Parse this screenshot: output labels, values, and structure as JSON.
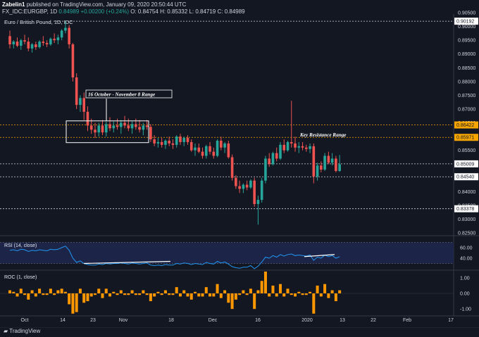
{
  "header": {
    "line1_user": "Zabelin1",
    "line1_rest": "published on TradingView.com, January 09, 2020 20:50:44 UTC",
    "symbol": "FX_IDC:EURGBP, 1D",
    "last": "0.84989",
    "change": "+0.00200 (+0.24%)",
    "o": "O: 0.84754",
    "h": "H: 0.85332",
    "l": "L: 0.84719",
    "c": "C: 0.84989"
  },
  "footer": {
    "brand": "TradingView"
  },
  "colors": {
    "bg": "#131722",
    "up": "#26a69a",
    "down": "#ef5350",
    "orange": "#f7a600",
    "rsi": "#2196f3",
    "roc": "#ff9800"
  },
  "chart_data": [
    {
      "type": "candlestick",
      "title": "Euro / British Pound, 1D, IDC",
      "ylim": [
        0.8245,
        0.9045
      ],
      "y_ticks": [
        "0.90500",
        "0.90000",
        "0.89500",
        "0.89000",
        "0.88500",
        "0.88000",
        "0.87500",
        "0.87000",
        "0.86500",
        "0.86000",
        "0.85500",
        "0.85000",
        "0.84500",
        "0.84000",
        "0.83500",
        "0.83000",
        "0.82500"
      ],
      "x_ticks": [
        "Oct",
        "14",
        "23",
        "Nov",
        "18",
        "Dec",
        "16",
        "2020",
        "13",
        "22",
        "Feb",
        "17"
      ],
      "price_labels": [
        {
          "text": "0.90192",
          "value": 0.90192
        },
        {
          "text": "0.86422",
          "value": 0.86422
        },
        {
          "text": "0.85971",
          "value": 0.85971
        },
        {
          "text": "0.85009",
          "value": 0.85009
        },
        {
          "text": "0.84540",
          "value": 0.8454
        },
        {
          "text": "0.83378",
          "value": 0.83378
        }
      ],
      "levels": [
        {
          "value": 0.90192,
          "style": "white-dashed"
        },
        {
          "value": 0.86422,
          "style": "orange-dashed"
        },
        {
          "value": 0.85971,
          "style": "orange-dashed"
        },
        {
          "value": 0.85009,
          "style": "white-dashed"
        },
        {
          "value": 0.8454,
          "style": "white-dashed"
        },
        {
          "value": 0.83378,
          "style": "white-dashed"
        }
      ],
      "annotations": {
        "range_label": "16 October - November 8 Range",
        "resistance_label": "Key Resistance Range"
      },
      "candles": [
        [
          0.8965,
          0.8985,
          0.892,
          0.8935
        ],
        [
          0.8935,
          0.895,
          0.892,
          0.8945
        ],
        [
          0.8945,
          0.896,
          0.8925,
          0.893
        ],
        [
          0.893,
          0.8955,
          0.8915,
          0.895
        ],
        [
          0.895,
          0.897,
          0.8935,
          0.8945
        ],
        [
          0.8945,
          0.896,
          0.891,
          0.892
        ],
        [
          0.892,
          0.894,
          0.8905,
          0.8935
        ],
        [
          0.8935,
          0.8945,
          0.8915,
          0.8925
        ],
        [
          0.8925,
          0.895,
          0.892,
          0.8945
        ],
        [
          0.8945,
          0.8965,
          0.893,
          0.894
        ],
        [
          0.894,
          0.895,
          0.8925,
          0.8935
        ],
        [
          0.8935,
          0.896,
          0.893,
          0.8955
        ],
        [
          0.8955,
          0.8975,
          0.894,
          0.895
        ],
        [
          0.895,
          0.897,
          0.8935,
          0.896
        ],
        [
          0.896,
          0.899,
          0.895,
          0.8985
        ],
        [
          0.8985,
          0.9019,
          0.8975,
          0.8995
        ],
        [
          0.8995,
          0.9005,
          0.892,
          0.8935
        ],
        [
          0.8935,
          0.894,
          0.88,
          0.8815
        ],
        [
          0.8815,
          0.883,
          0.87,
          0.8715
        ],
        [
          0.8715,
          0.875,
          0.869,
          0.874
        ],
        [
          0.874,
          0.876,
          0.866,
          0.869
        ],
        [
          0.869,
          0.871,
          0.862,
          0.864
        ],
        [
          0.864,
          0.8665,
          0.861,
          0.8625
        ],
        [
          0.8625,
          0.865,
          0.8595,
          0.8615
        ],
        [
          0.8615,
          0.865,
          0.86,
          0.864
        ],
        [
          0.864,
          0.866,
          0.8605,
          0.8615
        ],
        [
          0.8615,
          0.8655,
          0.86,
          0.8645
        ],
        [
          0.8645,
          0.867,
          0.862,
          0.863
        ],
        [
          0.863,
          0.8655,
          0.8615,
          0.864
        ],
        [
          0.864,
          0.8665,
          0.8625,
          0.8635
        ],
        [
          0.8635,
          0.866,
          0.861,
          0.865
        ],
        [
          0.865,
          0.8675,
          0.863,
          0.864
        ],
        [
          0.864,
          0.8665,
          0.862,
          0.863
        ],
        [
          0.863,
          0.8655,
          0.861,
          0.8645
        ],
        [
          0.8645,
          0.8665,
          0.8625,
          0.8635
        ],
        [
          0.8635,
          0.866,
          0.8615,
          0.8625
        ],
        [
          0.8625,
          0.865,
          0.8605,
          0.864
        ],
        [
          0.864,
          0.866,
          0.8625,
          0.8635
        ],
        [
          0.8635,
          0.8645,
          0.858,
          0.859
        ],
        [
          0.859,
          0.8605,
          0.8565,
          0.8575
        ],
        [
          0.8575,
          0.8595,
          0.856,
          0.858
        ],
        [
          0.858,
          0.8595,
          0.856,
          0.857
        ],
        [
          0.857,
          0.859,
          0.8555,
          0.8585
        ],
        [
          0.8585,
          0.86,
          0.8565,
          0.8575
        ],
        [
          0.8575,
          0.859,
          0.8555,
          0.857
        ],
        [
          0.857,
          0.8605,
          0.856,
          0.86
        ],
        [
          0.86,
          0.861,
          0.857,
          0.858
        ],
        [
          0.858,
          0.86,
          0.8565,
          0.8595
        ],
        [
          0.8595,
          0.8605,
          0.857,
          0.858
        ],
        [
          0.858,
          0.859,
          0.8545,
          0.855
        ],
        [
          0.855,
          0.8575,
          0.853,
          0.856
        ],
        [
          0.856,
          0.8575,
          0.854,
          0.8545
        ],
        [
          0.8545,
          0.856,
          0.852,
          0.853
        ],
        [
          0.853,
          0.857,
          0.852,
          0.8565
        ],
        [
          0.8565,
          0.858,
          0.8535,
          0.8545
        ],
        [
          0.8545,
          0.856,
          0.852,
          0.853
        ],
        [
          0.853,
          0.859,
          0.8525,
          0.8585
        ],
        [
          0.8585,
          0.86,
          0.855,
          0.856
        ],
        [
          0.856,
          0.858,
          0.854,
          0.8575
        ],
        [
          0.8575,
          0.8585,
          0.852,
          0.8525
        ],
        [
          0.8525,
          0.8535,
          0.844,
          0.845
        ],
        [
          0.845,
          0.846,
          0.841,
          0.842
        ],
        [
          0.842,
          0.844,
          0.8395,
          0.841
        ],
        [
          0.841,
          0.843,
          0.8395,
          0.8425
        ],
        [
          0.8425,
          0.844,
          0.8405,
          0.8415
        ],
        [
          0.8415,
          0.8445,
          0.841,
          0.844
        ],
        [
          0.844,
          0.845,
          0.8345,
          0.8355
        ],
        [
          0.8355,
          0.8385,
          0.828,
          0.837
        ],
        [
          0.837,
          0.845,
          0.836,
          0.844
        ],
        [
          0.844,
          0.853,
          0.843,
          0.852
        ],
        [
          0.852,
          0.854,
          0.849,
          0.85
        ],
        [
          0.85,
          0.8545,
          0.8495,
          0.854
        ],
        [
          0.854,
          0.856,
          0.851,
          0.852
        ],
        [
          0.852,
          0.858,
          0.8515,
          0.857
        ],
        [
          0.857,
          0.859,
          0.854,
          0.855
        ],
        [
          0.855,
          0.8585,
          0.8545,
          0.858
        ],
        [
          0.858,
          0.873,
          0.856,
          0.8575
        ],
        [
          0.8575,
          0.86,
          0.8545,
          0.856
        ],
        [
          0.856,
          0.858,
          0.854,
          0.8565
        ],
        [
          0.8565,
          0.858,
          0.855,
          0.856
        ],
        [
          0.856,
          0.857,
          0.8545,
          0.8555
        ],
        [
          0.8555,
          0.8575,
          0.854,
          0.8565
        ],
        [
          0.8565,
          0.8575,
          0.843,
          0.8455
        ],
        [
          0.8455,
          0.8505,
          0.844,
          0.8495
        ],
        [
          0.8495,
          0.851,
          0.847,
          0.848
        ],
        [
          0.848,
          0.854,
          0.8475,
          0.853
        ],
        [
          0.853,
          0.8545,
          0.85,
          0.8505
        ],
        [
          0.8505,
          0.854,
          0.8495,
          0.852
        ],
        [
          0.852,
          0.853,
          0.847,
          0.8475
        ],
        [
          0.8475,
          0.8533,
          0.8472,
          0.8499
        ]
      ]
    },
    {
      "type": "line",
      "title": "RSI (14, close)",
      "ylim": [
        20,
        80
      ],
      "y_ticks": [
        "60.00",
        "40.00"
      ],
      "levels": [
        70,
        30
      ],
      "values": [
        55,
        56,
        54,
        57,
        56,
        53,
        55,
        54,
        56,
        55,
        54,
        57,
        56,
        57,
        60,
        63,
        55,
        40,
        32,
        35,
        30,
        28,
        27,
        27,
        29,
        28,
        30,
        29,
        30,
        30,
        31,
        30,
        29,
        31,
        30,
        29,
        30,
        31,
        27,
        26,
        27,
        26,
        28,
        27,
        27,
        30,
        29,
        31,
        30,
        28,
        30,
        29,
        28,
        32,
        30,
        29,
        34,
        31,
        33,
        29,
        24,
        22,
        21,
        23,
        23,
        26,
        20,
        25,
        33,
        42,
        40,
        45,
        42,
        47,
        44,
        47,
        48,
        45,
        46,
        45,
        44,
        46,
        36,
        42,
        40,
        46,
        43,
        45,
        40,
        43
      ],
      "trend_lines": [
        [
          [
            41,
            30
          ],
          [
            78,
            34
          ]
        ],
        [
          [
            149,
            43
          ],
          [
            162,
            47
          ]
        ]
      ]
    },
    {
      "type": "bar",
      "title": "ROC (1, close)",
      "ylim": [
        -1.4,
        1.4
      ],
      "y_ticks": [
        "1.00",
        "0.00",
        "-1.00"
      ],
      "values": [
        0.2,
        0.1,
        -0.2,
        0.3,
        -0.1,
        -0.4,
        0.2,
        -0.2,
        0.3,
        -0.1,
        -0.1,
        0.3,
        -0.1,
        0.2,
        0.3,
        0.1,
        -0.7,
        -1.3,
        -1.2,
        0.3,
        -0.6,
        -0.5,
        -0.2,
        -0.1,
        0.3,
        -0.3,
        0.3,
        -0.2,
        0.1,
        -0.1,
        0.2,
        -0.1,
        -0.1,
        0.2,
        -0.1,
        -0.1,
        0.2,
        -0.1,
        -0.5,
        -0.2,
        0.1,
        -0.1,
        0.2,
        -0.1,
        -0.1,
        0.4,
        -0.2,
        0.2,
        -0.2,
        -0.4,
        0.1,
        -0.2,
        -0.2,
        0.4,
        -0.2,
        -0.2,
        0.6,
        -0.3,
        0.2,
        -0.6,
        -1.0,
        -0.4,
        -0.1,
        0.2,
        -0.1,
        0.3,
        -1.0,
        0.2,
        0.8,
        1.4,
        -0.2,
        0.5,
        -0.2,
        0.6,
        -0.2,
        0.3,
        -0.1,
        -0.2,
        0.1,
        -0.1,
        -0.1,
        0.1,
        -1.3,
        0.5,
        -0.2,
        0.6,
        -0.3,
        0.2,
        -0.5,
        0.2
      ]
    }
  ]
}
